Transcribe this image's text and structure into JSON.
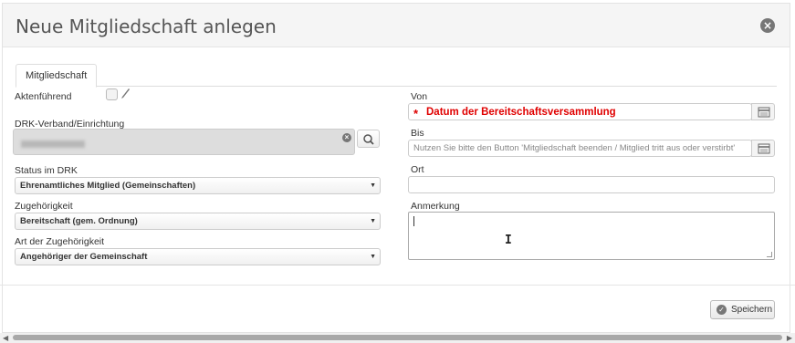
{
  "dialog": {
    "title": "Neue Mitgliedschaft anlegen",
    "close_icon": "close-circle-icon"
  },
  "tabs": [
    {
      "label": "Mitgliedschaft",
      "active": true
    }
  ],
  "left": {
    "aktenfuehrend_label": "Aktenführend",
    "aktenfuehrend_checked": false,
    "verband_label": "DRK-Verband/Einrichtung",
    "status_label": "Status im DRK",
    "status_value": "Ehrenamtliches Mitglied (Gemeinschaften)",
    "zugehoerigkeit_label": "Zugehörigkeit",
    "zugehoerigkeit_value": "Bereitschaft (gem. Ordnung)",
    "art_label": "Art der Zugehörigkeit",
    "art_value": "Angehöriger der Gemeinschaft"
  },
  "right": {
    "von_label": "Von",
    "von_required_marker": "*",
    "von_value": "Datum der Bereitschaftsversammlung",
    "bis_label": "Bis",
    "bis_placeholder": "Nutzen Sie bitte den Button 'Mitgliedschaft beenden / Mitglied tritt aus oder verstirbt'",
    "ort_label": "Ort",
    "ort_value": "",
    "anmerkung_label": "Anmerkung",
    "anmerkung_value": ""
  },
  "footer": {
    "save_label": "Speichern"
  },
  "colors": {
    "required": "#e00000",
    "header_bg": "#f5f5f5"
  }
}
